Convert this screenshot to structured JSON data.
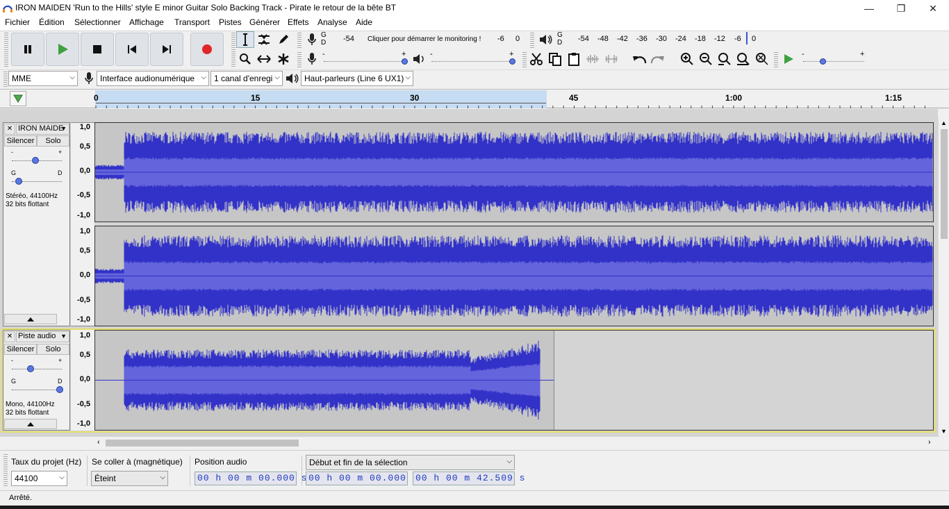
{
  "window": {
    "title": "IRON MAIDEN 'Run to the Hills' style E minor Guitar Solo Backing Track - Pirate le retour de la bête BT",
    "minimize": "—",
    "restore": "❐",
    "close": "✕"
  },
  "menu": [
    "Fichier",
    "Édition",
    "Sélectionner",
    "Affichage",
    "Transport",
    "Pistes",
    "Générer",
    "Effets",
    "Analyse",
    "Aide"
  ],
  "transport": {
    "pause": "pause-icon",
    "play": "play-icon",
    "stop": "stop-icon",
    "skip_start": "skip-start-icon",
    "skip_end": "skip-end-icon",
    "record": "record-icon",
    "record_color": "#e0262b",
    "play_color": "#3fa13f"
  },
  "recording_meter": {
    "lr_top": "G",
    "lr_bottom": "D",
    "scale": [
      "-54",
      "Cliquer pour démarrer le monitoring !",
      "-6",
      "0"
    ]
  },
  "playback_meter": {
    "lr_top": "G",
    "lr_bottom": "D",
    "scale": [
      "-54",
      "-48",
      "-42",
      "-36",
      "-30",
      "-24",
      "-18",
      "-12",
      "-6",
      "0"
    ]
  },
  "slider_signs": {
    "minus": "-",
    "plus": "+"
  },
  "device": {
    "host": "MME",
    "input": "Interface audionumérique",
    "channels": "1 canal d'enregi",
    "output": "Haut-parleurs (Line 6 UX1)"
  },
  "timeline": {
    "ticks": [
      "0",
      "15",
      "30",
      "45",
      "1:00",
      "1:15"
    ]
  },
  "tracks": [
    {
      "name": "IRON MAIDE",
      "close": "✕",
      "mute": "Silencer",
      "solo": "Solo",
      "pan_left": "G",
      "pan_right": "D",
      "gain_minus": "-",
      "gain_plus": "+",
      "info1": "Stéréo, 44100Hz",
      "info2": "32 bits flottant",
      "scale": [
        "1,0",
        "0,5",
        "0,0",
        "-0,5",
        "-1,0"
      ]
    },
    {
      "name": "Piste audio",
      "close": "✕",
      "mute": "Silencer",
      "solo": "Solo",
      "pan_left": "G",
      "pan_right": "D",
      "gain_minus": "-",
      "gain_plus": "+",
      "info1": "Mono, 44100Hz",
      "info2": "32 bits flottant",
      "scale": [
        "1,0",
        "0,5",
        "0,0",
        "-0,5",
        "-1,0"
      ]
    }
  ],
  "selection_bar": {
    "rate_label": "Taux du projet (Hz)",
    "rate_value": "44100",
    "snap_label": "Se coller à (magnétique)",
    "snap_value": "Éteint",
    "pos_label": "Position audio",
    "pos_value": "00 h 00 m 00.000 s",
    "sel_mode": "Début et fin de la sélection",
    "sel_start": "00 h 00 m 00.000 s",
    "sel_end": "00 h 00 m 42.509 s"
  },
  "status": "Arrêté.",
  "colors": {
    "wave": "#3232c8",
    "wave_rms": "#6464dc",
    "wave_bg": "#c6c6c6",
    "selection": "#d4e4f4"
  }
}
